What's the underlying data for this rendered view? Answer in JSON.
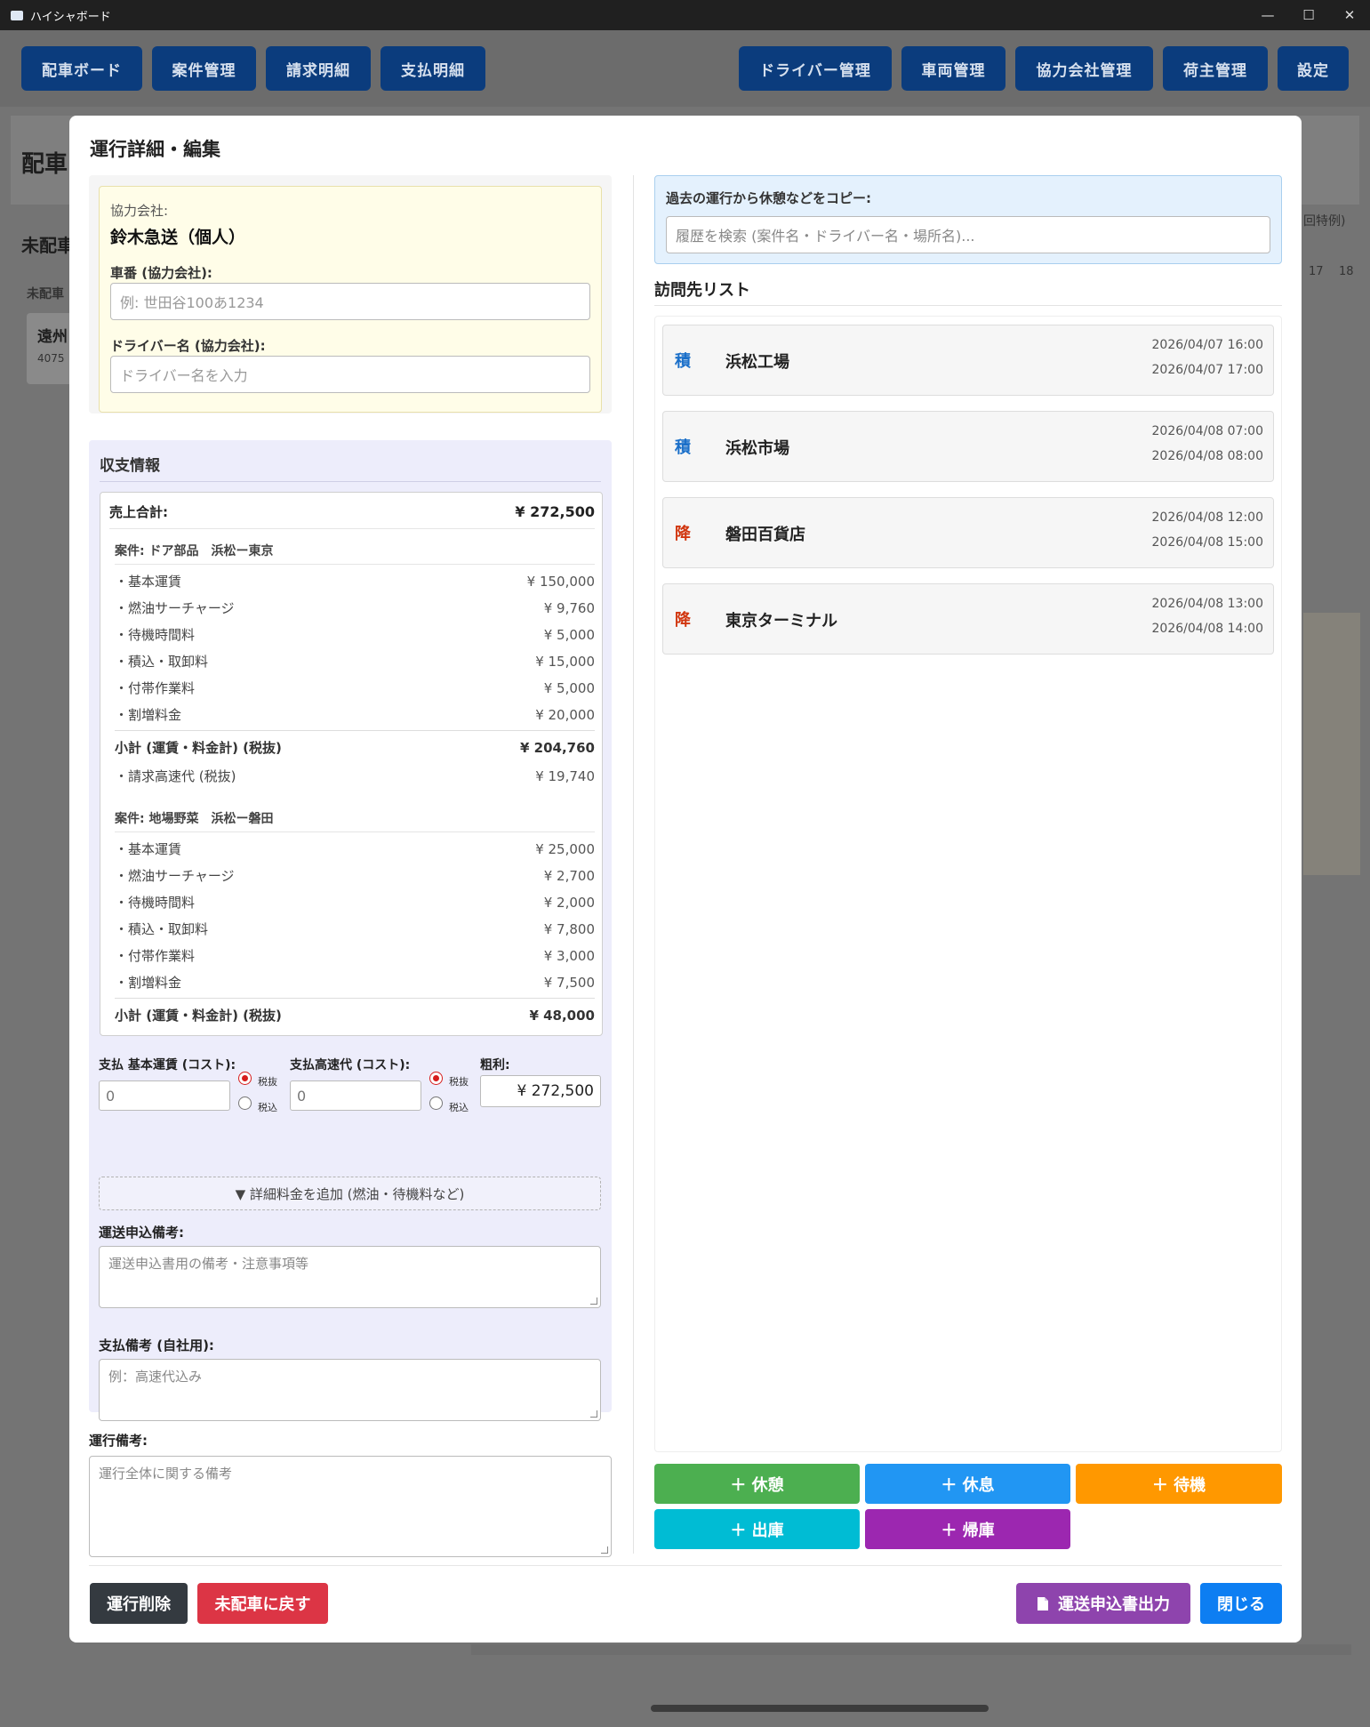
{
  "window": {
    "title": "ハイシャボード",
    "minimize_glyph": "—",
    "maximize_glyph": "☐",
    "close_glyph": "✕"
  },
  "nav": {
    "left": [
      "配車ボード",
      "案件管理",
      "請求明細",
      "支払明細"
    ],
    "right": [
      "ドライバー管理",
      "車両管理",
      "協力会社管理",
      "荷主管理",
      "設定"
    ]
  },
  "background": {
    "page_title": "配車",
    "unassigned_title": "未配車",
    "unassigned_label": "未配車",
    "card_title": "遠州",
    "card_sub": "4075",
    "special": "回特例)",
    "hours": [
      "17",
      "18"
    ]
  },
  "modal": {
    "title": "運行詳細・編集",
    "partner": {
      "company_label": "協力会社:",
      "company_name": "鈴木急送（個人）",
      "vehicle_label": "車番 (協力会社):",
      "vehicle_placeholder": "例: 世田谷100あ1234",
      "driver_label": "ドライバー名 (協力会社):",
      "driver_placeholder": "ドライバー名を入力"
    },
    "finance": {
      "heading": "収支情報",
      "sales_total_label": "売上合計:",
      "sales_total": "¥ 272,500",
      "cases": [
        {
          "title": "案件: ドア部品　浜松ー東京",
          "items": [
            {
              "label": "・基本運賃",
              "value": "¥ 150,000"
            },
            {
              "label": "・燃油サーチャージ",
              "value": "¥ 9,760"
            },
            {
              "label": "・待機時間料",
              "value": "¥ 5,000"
            },
            {
              "label": "・積込・取卸料",
              "value": "¥ 15,000"
            },
            {
              "label": "・付帯作業料",
              "value": "¥ 5,000"
            },
            {
              "label": "・割増料金",
              "value": "¥ 20,000"
            }
          ],
          "subtotal_label": "小計 (運賃・料金計) (税抜)",
          "subtotal": "¥ 204,760",
          "toll_label": "・請求高速代 (税抜)",
          "toll": "¥ 19,740"
        },
        {
          "title": "案件: 地場野菜　浜松ー磐田",
          "items": [
            {
              "label": "・基本運賃",
              "value": "¥ 25,000"
            },
            {
              "label": "・燃油サーチャージ",
              "value": "¥ 2,700"
            },
            {
              "label": "・待機時間料",
              "value": "¥ 2,000"
            },
            {
              "label": "・積込・取卸料",
              "value": "¥ 7,800"
            },
            {
              "label": "・付帯作業料",
              "value": "¥ 3,000"
            },
            {
              "label": "・割増料金",
              "value": "¥ 7,500"
            }
          ],
          "subtotal_label": "小計 (運賃・料金計) (税抜)",
          "subtotal": "¥ 48,000"
        }
      ],
      "pay_base_label": "支払 基本運賃 (コスト):",
      "pay_base_value": "0",
      "pay_toll_label": "支払高速代 (コスト):",
      "pay_toll_value": "0",
      "tax_excl": "税抜",
      "tax_incl": "税込",
      "gross_label": "粗利:",
      "gross_value": "¥ 272,500",
      "add_fee": "▼ 詳細料金を追加 (燃油・待機料など)",
      "transport_note_label": "運送申込備考:",
      "transport_note_placeholder": "運送申込書用の備考・注意事項等",
      "pay_note_label": "支払備考 (自社用):",
      "pay_note_placeholder": "例：高速代込み"
    },
    "operation_note_label": "運行備考:",
    "operation_note_placeholder": "運行全体に関する備考",
    "copy": {
      "label": "過去の運行から休憩などをコピー:",
      "placeholder": "履歴を検索 (案件名・ドライバー名・場所名)..."
    },
    "visits_heading": "訪問先リスト",
    "visits": [
      {
        "kind": "積",
        "kind_color": "#1a6fc9",
        "place": "浜松工場",
        "start": "2026/04/07 16:00",
        "end": "2026/04/07 17:00"
      },
      {
        "kind": "積",
        "kind_color": "#1a6fc9",
        "place": "浜松市場",
        "start": "2026/04/08 07:00",
        "end": "2026/04/08 08:00"
      },
      {
        "kind": "降",
        "kind_color": "#d1360f",
        "place": "磐田百貨店",
        "start": "2026/04/08 12:00",
        "end": "2026/04/08 15:00"
      },
      {
        "kind": "降",
        "kind_color": "#d1360f",
        "place": "東京ターミナル",
        "start": "2026/04/08 13:00",
        "end": "2026/04/08 14:00"
      }
    ],
    "actions": [
      {
        "label": "＋ 休憩",
        "color": "#4caf50"
      },
      {
        "label": "＋ 休息",
        "color": "#2196f3"
      },
      {
        "label": "＋ 待機",
        "color": "#ff9800"
      },
      {
        "label": "＋ 出庫",
        "color": "#00bcd4"
      },
      {
        "label": "＋ 帰庫",
        "color": "#9c27b0"
      }
    ],
    "footer": {
      "delete": "運行削除",
      "unassign": "未配車に戻す",
      "export": "運送申込書出力",
      "close": "閉じる"
    }
  }
}
